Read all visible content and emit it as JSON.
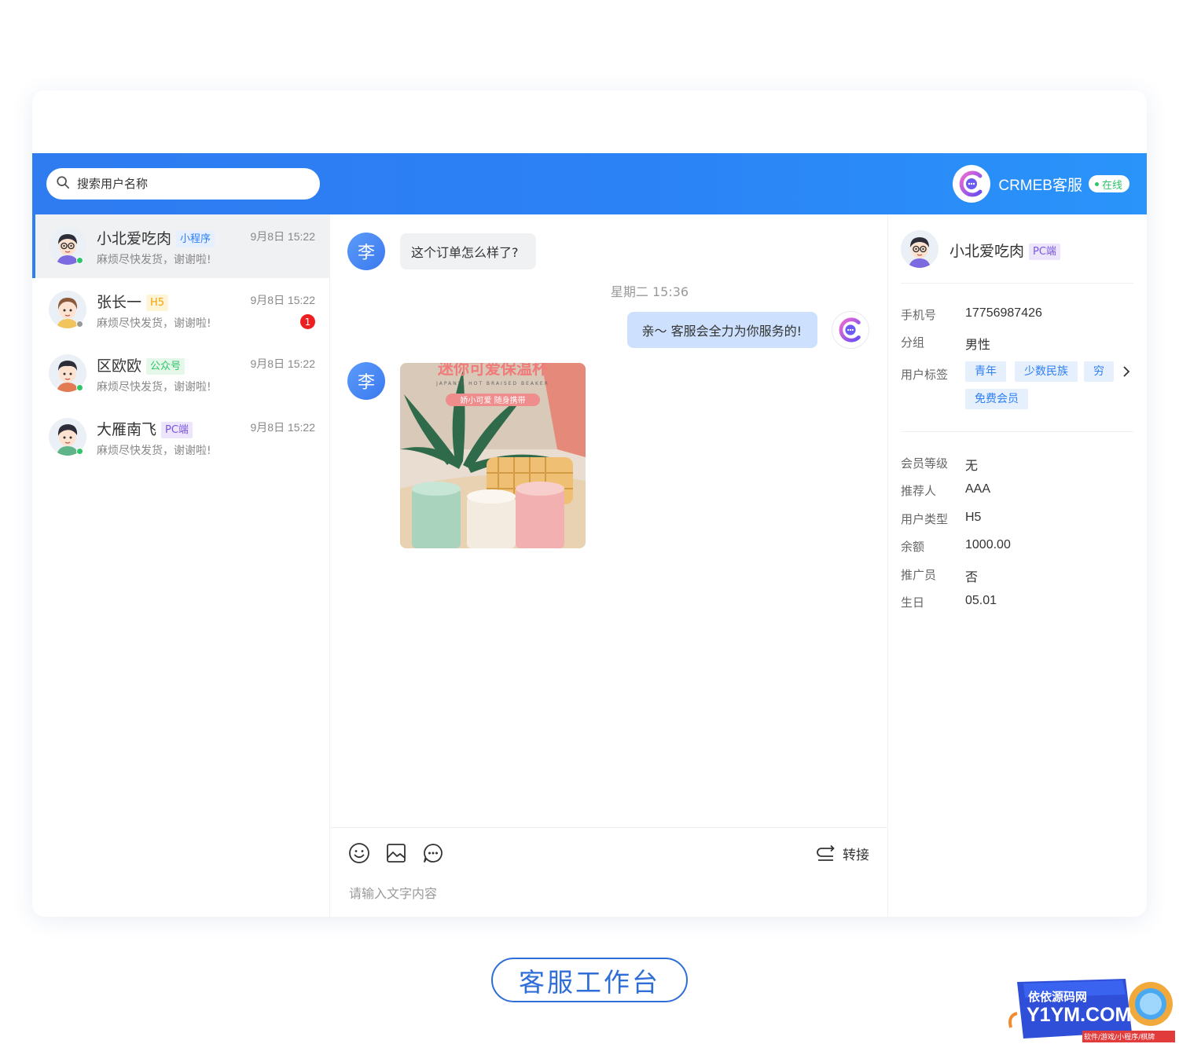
{
  "search": {
    "placeholder": "搜索用户名称"
  },
  "agent": {
    "name": "CRMEB客服",
    "status": "在线"
  },
  "conversations": [
    {
      "name": "小北爱吃肉",
      "tag": "小程序",
      "preview": "麻烦尽快发货，谢谢啦!",
      "time": "9月8日 15:22",
      "online": true
    },
    {
      "name": "张长一",
      "tag": "H5",
      "preview": "麻烦尽快发货，谢谢啦!",
      "time": "9月8日 15:22",
      "online": false,
      "unread": "1"
    },
    {
      "name": "区欧欧",
      "tag": "公众号",
      "preview": "麻烦尽快发货，谢谢啦!",
      "time": "9月8日 15:22",
      "online": true
    },
    {
      "name": "大雁南飞",
      "tag": "PC端",
      "preview": "麻烦尽快发货，谢谢啦!",
      "time": "9月8日 15:22",
      "online": true
    }
  ],
  "chat": {
    "customer_avatar_text": "李",
    "messages": [
      {
        "from": "customer",
        "text": "这个订单怎么样了?"
      },
      {
        "type": "timestamp",
        "text": "星期二 15:36"
      },
      {
        "from": "agent",
        "text": "亲～ 客服会全力为你服务的!"
      },
      {
        "from": "customer",
        "type": "image"
      }
    ],
    "image_texts": {
      "title": "迷你可爱保温杯",
      "subtitle": "JAPAN'S HOT BRAISED BEAKER",
      "tagline": "娇小可爱 随身携带"
    }
  },
  "composer": {
    "transfer_label": "转接",
    "input_placeholder": "请输入文字内容",
    "tools": [
      "emoji-icon",
      "image-icon",
      "quick-reply-icon"
    ]
  },
  "profile": {
    "name": "小北爱吃肉",
    "tag": "PC端",
    "phone_label": "手机号",
    "phone": "17756987426",
    "group_label": "分组",
    "group": "男性",
    "labels_label": "用户标签",
    "labels": [
      "青年",
      "少数民族",
      "穷",
      "免费会员"
    ],
    "level_label": "会员等级",
    "level": "无",
    "referrer_label": "推荐人",
    "referrer": "AAA",
    "user_type_label": "用户类型",
    "user_type": "H5",
    "balance_label": "余额",
    "balance": "1000.00",
    "promoter_label": "推广员",
    "promoter": "否",
    "birthday_label": "生日",
    "birthday": "05.01"
  },
  "caption": "客服工作台",
  "watermark": {
    "line1": "依依源码网",
    "line2": "Y1YM.COM",
    "line3": "软件/游戏/小程序/棋牌"
  },
  "colors": {
    "primary": "#2d7ff2",
    "online": "#2ec56b",
    "unread": "#ee1f1f"
  }
}
